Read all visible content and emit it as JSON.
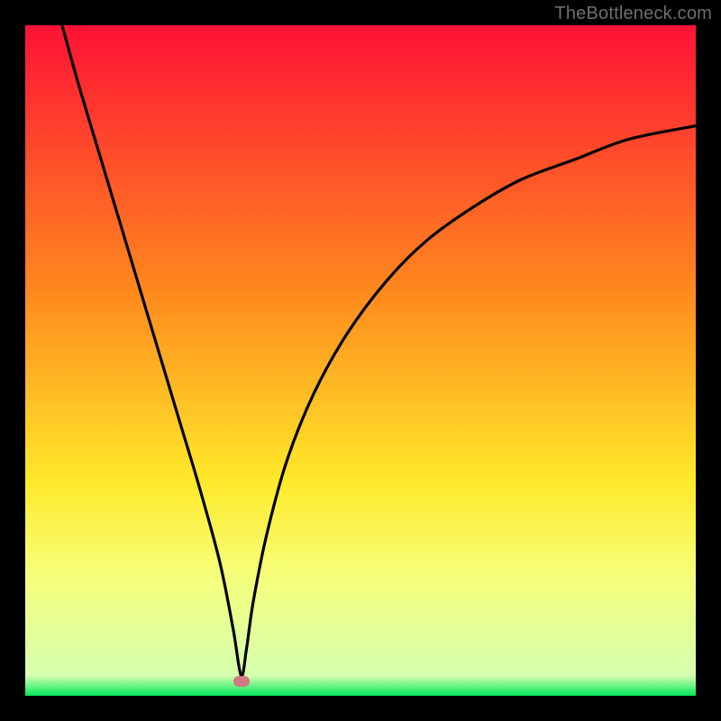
{
  "watermark": "TheBottleneck.com",
  "colors": {
    "top": "#ff1236",
    "mid_upper": "#ff8a1e",
    "mid": "#ffe92a",
    "mid_lower": "#f6ff7a",
    "green": "#00e85b",
    "curve": "#000000",
    "bg": "#000000",
    "marker": "#cf7a7f"
  },
  "chart_data": {
    "type": "line",
    "title": "",
    "xlabel": "",
    "ylabel": "",
    "xlim": [
      0,
      100
    ],
    "ylim": [
      0,
      100
    ],
    "series": [
      {
        "name": "bottleneck-curve",
        "x": [
          5.5,
          8,
          11,
          14,
          17,
          20,
          23,
          26,
          29,
          31,
          32.2,
          33,
          34,
          36,
          39,
          43,
          48,
          54,
          60,
          67,
          74,
          82,
          90,
          100
        ],
        "y": [
          100,
          91,
          81,
          71,
          61,
          51,
          41,
          31,
          20,
          10,
          3,
          7,
          14,
          24,
          35,
          45,
          54,
          62,
          68,
          73,
          77,
          80,
          83,
          85
        ]
      }
    ],
    "marker": {
      "x": 32.2,
      "y": 2.2
    },
    "gradient_stops": [
      {
        "pct": 0,
        "color": "#ff1236"
      },
      {
        "pct": 40,
        "color": "#ff8a1e"
      },
      {
        "pct": 68,
        "color": "#ffe92a"
      },
      {
        "pct": 82,
        "color": "#f6ff7a"
      },
      {
        "pct": 97,
        "color": "#d6ffb0"
      },
      {
        "pct": 100,
        "color": "#00e85b"
      }
    ]
  }
}
